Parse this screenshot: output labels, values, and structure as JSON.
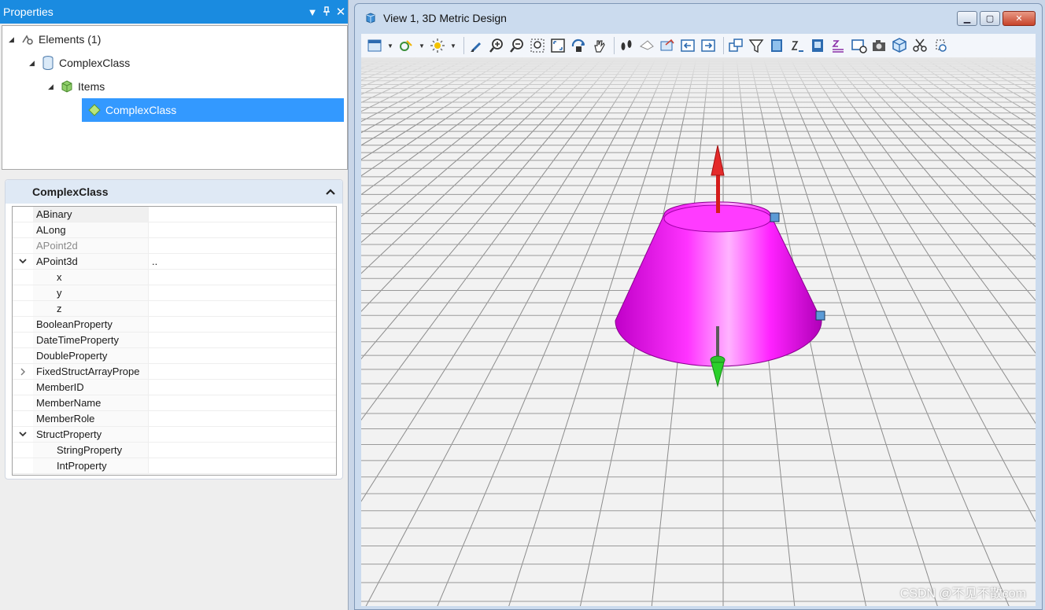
{
  "properties_panel": {
    "title": "Properties",
    "tree": {
      "elements_label": "Elements (1)",
      "complex_class_label": "ComplexClass",
      "items_label": "Items",
      "selected_label": "ComplexClass"
    },
    "group_title": "ComplexClass",
    "rows": [
      {
        "name": "ABinary",
        "value": "",
        "expander": "",
        "child": false,
        "disabled": false
      },
      {
        "name": "ALong",
        "value": "",
        "expander": "",
        "child": false,
        "disabled": false
      },
      {
        "name": "APoint2d",
        "value": "",
        "expander": "",
        "child": false,
        "disabled": true
      },
      {
        "name": "APoint3d",
        "value": "..",
        "expander": "v",
        "child": false,
        "disabled": false
      },
      {
        "name": "x",
        "value": "",
        "expander": "",
        "child": true,
        "disabled": false
      },
      {
        "name": "y",
        "value": "",
        "expander": "",
        "child": true,
        "disabled": false
      },
      {
        "name": "z",
        "value": "",
        "expander": "",
        "child": true,
        "disabled": false
      },
      {
        "name": "BooleanProperty",
        "value": "",
        "expander": "",
        "child": false,
        "disabled": false
      },
      {
        "name": "DateTimeProperty",
        "value": "",
        "expander": "",
        "child": false,
        "disabled": false
      },
      {
        "name": "DoubleProperty",
        "value": "",
        "expander": "",
        "child": false,
        "disabled": false
      },
      {
        "name": "FixedStructArrayPrope",
        "value": "",
        "expander": ">",
        "child": false,
        "disabled": false
      },
      {
        "name": "MemberID",
        "value": "",
        "expander": "",
        "child": false,
        "disabled": false
      },
      {
        "name": "MemberName",
        "value": "",
        "expander": "",
        "child": false,
        "disabled": false
      },
      {
        "name": "MemberRole",
        "value": "",
        "expander": "",
        "child": false,
        "disabled": false
      },
      {
        "name": "StructProperty",
        "value": "",
        "expander": "v",
        "child": false,
        "disabled": false
      },
      {
        "name": "StringProperty",
        "value": "",
        "expander": "",
        "child": true,
        "disabled": false
      },
      {
        "name": "IntProperty",
        "value": "",
        "expander": "",
        "child": true,
        "disabled": false
      }
    ]
  },
  "view": {
    "title": "View 1, 3D Metric Design",
    "toolbar_icons": [
      "view-attributes-icon",
      "display-style-icon",
      "lighting-icon",
      "update-view-icon",
      "zoom-in-icon",
      "zoom-out-icon",
      "zoom-area-icon",
      "fit-view-icon",
      "rotate-view-icon",
      "pan-view-icon",
      "walk-icon",
      "look-icon",
      "camera-icon",
      "previous-view-icon",
      "next-view-icon",
      "copy-view-icon",
      "clip-volume-icon",
      "clip-mask-icon",
      "view-layout-icon",
      "level-display-icon",
      "reference-icon",
      "view-toggle-icon",
      "snapshot-icon",
      "3d-box-icon",
      "cut-icon",
      "clip-icon"
    ],
    "watermark": "CSDN @不见不散com"
  },
  "colors": {
    "title_blue": "#1a8be0",
    "selection_blue": "#3399ff",
    "cone_magenta": "#ff00ff",
    "arrow_red": "#e01818",
    "arrow_green": "#1fb81f"
  }
}
